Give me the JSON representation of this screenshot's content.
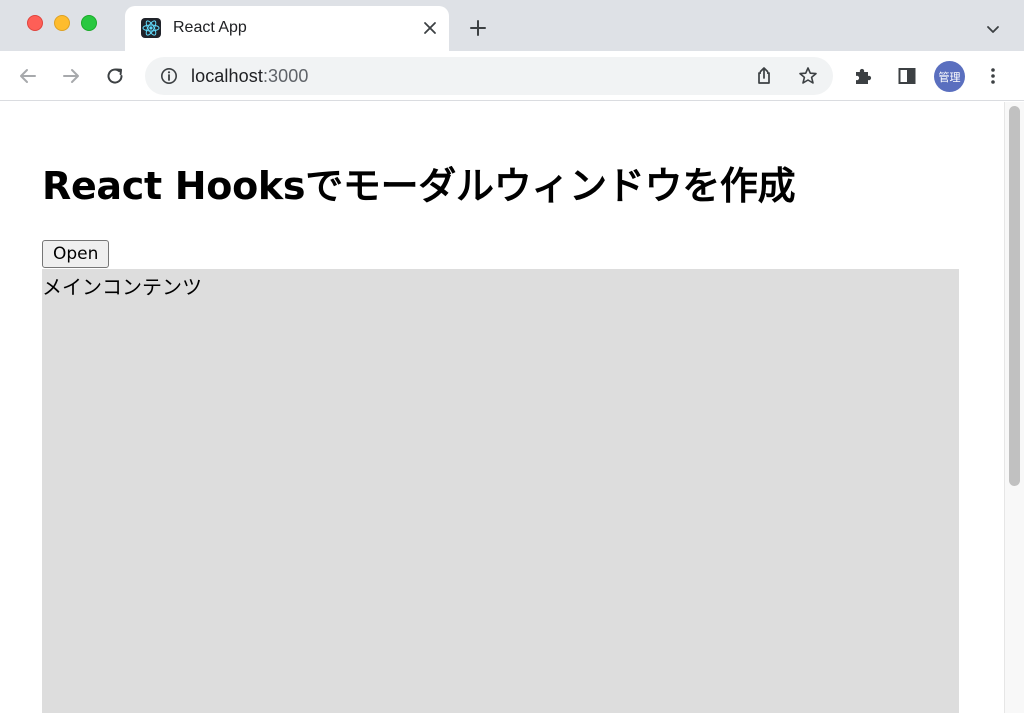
{
  "browser": {
    "tab": {
      "title": "React App",
      "favicon": "react-logo-icon"
    },
    "address_bar": {
      "host": "localhost",
      "port": ":3000"
    },
    "profile": {
      "label": "管理",
      "color": "#5a6fbf"
    },
    "colors": {
      "tabstrip": "#dee1e6",
      "omnibox": "#f1f3f4"
    }
  },
  "page": {
    "title": "React Hooksでモーダルウィンドウを作成",
    "open_button_label": "Open",
    "main_content_text": "メインコンテンツ",
    "main_content_bg": "#dddddd"
  }
}
